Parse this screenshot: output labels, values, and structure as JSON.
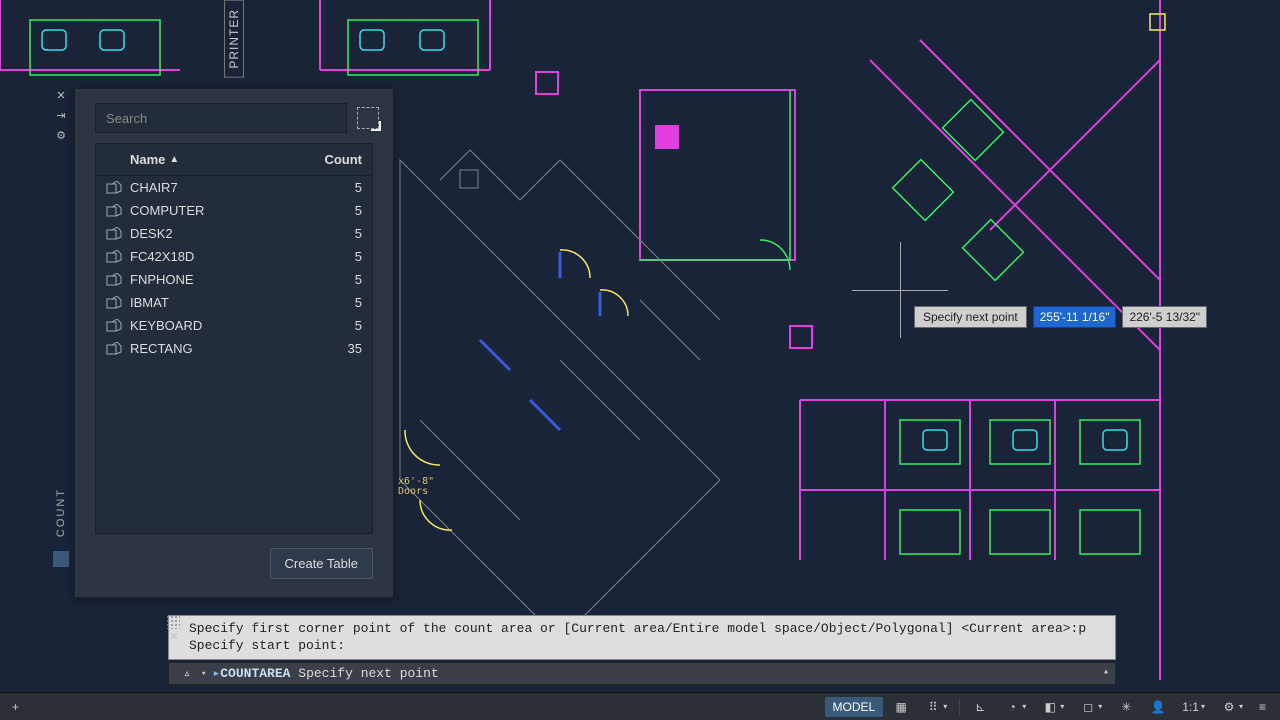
{
  "printer_label": "PRINTER",
  "side_rail": {
    "vertical_label": "COUNT"
  },
  "panel": {
    "search_placeholder": "Search",
    "columns": {
      "name": "Name",
      "count": "Count"
    },
    "create_button": "Create Table",
    "rows": [
      {
        "name": "CHAIR7",
        "count": 5
      },
      {
        "name": "COMPUTER",
        "count": 5
      },
      {
        "name": "DESK2",
        "count": 5
      },
      {
        "name": "FC42X18D",
        "count": 5
      },
      {
        "name": "FNPHONE",
        "count": 5
      },
      {
        "name": "IBMAT",
        "count": 5
      },
      {
        "name": "KEYBOARD",
        "count": 5
      },
      {
        "name": "RECTANG",
        "count": 35
      }
    ]
  },
  "dynamic_input": {
    "prompt": "Specify next point",
    "field1": "255'-11 1/16\"",
    "field2": "226'-5 13/32\""
  },
  "command": {
    "history_line1": "Specify first corner point of the count area or [Current area/Entire model space/Object/Polygonal] <Current area>:p",
    "history_line2": "Specify start point:",
    "cmd_keyword": "COUNTAREA",
    "cmd_rest": "Specify next point"
  },
  "statusbar": {
    "plus": "+",
    "model": "MODEL",
    "scale": "1:1",
    "menu": "≡"
  },
  "drawing_annotation": "x6'-8\"\nDoors"
}
